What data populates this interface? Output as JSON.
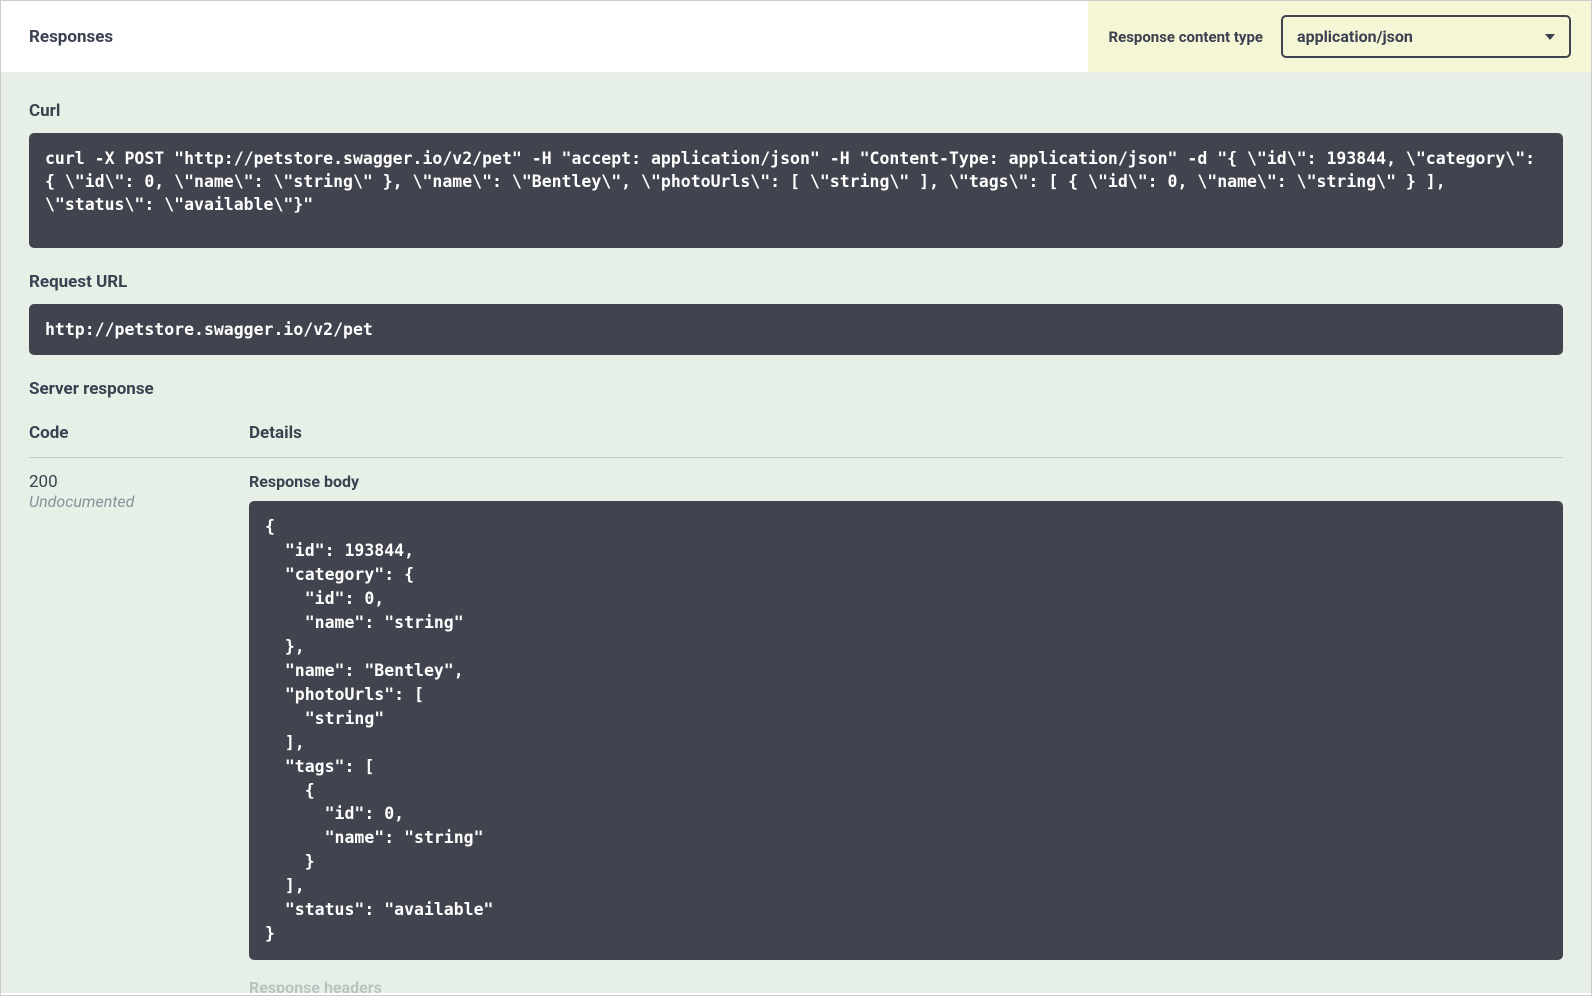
{
  "header": {
    "title": "Responses",
    "content_type_label": "Response content type",
    "content_type_value": "application/json"
  },
  "curl": {
    "heading": "Curl",
    "command": "curl -X POST \"http://petstore.swagger.io/v2/pet\" -H \"accept: application/json\" -H \"Content-Type: application/json\" -d \"{ \\\"id\\\": 193844, \\\"category\\\": { \\\"id\\\": 0, \\\"name\\\": \\\"string\\\" }, \\\"name\\\": \\\"Bentley\\\", \\\"photoUrls\\\": [ \\\"string\\\" ], \\\"tags\\\": [ { \\\"id\\\": 0, \\\"name\\\": \\\"string\\\" } ], \\\"status\\\": \\\"available\\\"}\""
  },
  "request_url": {
    "heading": "Request URL",
    "value": "http://petstore.swagger.io/v2/pet"
  },
  "server_response": {
    "heading": "Server response",
    "col_code": "Code",
    "col_details": "Details",
    "code": "200",
    "undocumented": "Undocumented",
    "response_body_heading": "Response body",
    "response_body": "{\n  \"id\": 193844,\n  \"category\": {\n    \"id\": 0,\n    \"name\": \"string\"\n  },\n  \"name\": \"Bentley\",\n  \"photoUrls\": [\n    \"string\"\n  ],\n  \"tags\": [\n    {\n      \"id\": 0,\n      \"name\": \"string\"\n    }\n  ],\n  \"status\": \"available\"\n}",
    "response_headers_heading": "Response headers"
  }
}
